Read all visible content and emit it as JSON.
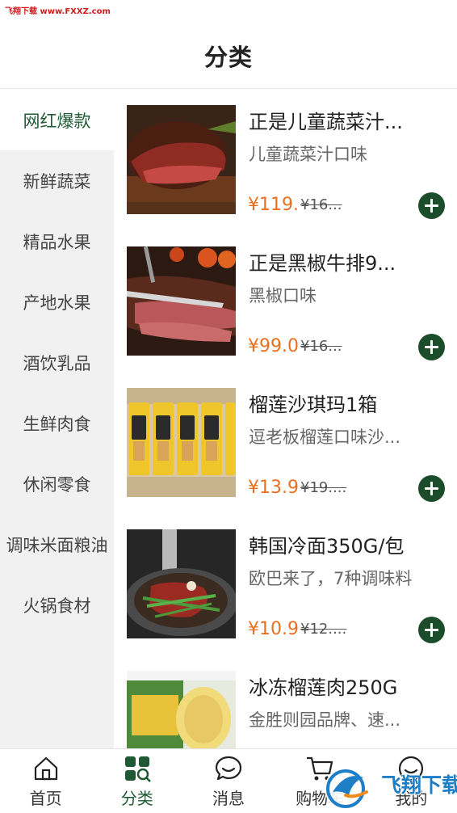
{
  "watermark": {
    "text": "飞翔下载 www.FXXZ.com"
  },
  "header": {
    "title": "分类"
  },
  "sidebar": {
    "items": [
      {
        "label": "网红爆款",
        "active": true
      },
      {
        "label": "新鲜蔬菜",
        "active": false
      },
      {
        "label": "精品水果",
        "active": false
      },
      {
        "label": "产地水果",
        "active": false
      },
      {
        "label": "酒饮乳品",
        "active": false
      },
      {
        "label": "生鲜肉食",
        "active": false
      },
      {
        "label": "休闲零食",
        "active": false
      },
      {
        "label": "调味米面粮油",
        "active": false
      },
      {
        "label": "火锅食材",
        "active": false
      }
    ]
  },
  "products": [
    {
      "title": "正是儿童蔬菜汁...",
      "subtitle": "儿童蔬菜汁口味",
      "price": "¥119.",
      "old_price": "¥16...",
      "image": "steak-on-board-photo"
    },
    {
      "title": "正是黑椒牛排9...",
      "subtitle": "黑椒口味",
      "price": "¥99.0",
      "old_price": "¥16...",
      "image": "sliced-steak-knife-photo"
    },
    {
      "title": "榴莲沙琪玛1箱",
      "subtitle": "逗老板榴莲口味沙...",
      "price": "¥13.9",
      "old_price": "¥19....",
      "image": "sachima-packs-photo"
    },
    {
      "title": "韩国冷面350G/包",
      "subtitle": "欧巴来了，7种调味料",
      "price": "¥10.9",
      "old_price": "¥12....",
      "image": "cold-noodles-photo"
    },
    {
      "title": "冰冻榴莲肉250G",
      "subtitle": "金胜则园品牌、速...",
      "price": "",
      "old_price": "",
      "image": "durian-box-photo"
    }
  ],
  "tabbar": {
    "items": [
      {
        "label": "首页",
        "icon": "home-icon",
        "active": false
      },
      {
        "label": "分类",
        "icon": "category-grid-icon",
        "active": true
      },
      {
        "label": "消息",
        "icon": "chat-bubble-icon",
        "active": false
      },
      {
        "label": "购物车",
        "icon": "cart-icon",
        "active": false
      },
      {
        "label": "我的",
        "icon": "profile-icon",
        "active": false
      }
    ]
  },
  "brand_watermark": {
    "text": "飞翔下载",
    "icon": "bird-logo-icon"
  },
  "colors": {
    "accent": "#1f5a34",
    "price": "#e8701e",
    "add_button": "#1b4d2b",
    "sidebar_bg": "#f1f1f1"
  }
}
